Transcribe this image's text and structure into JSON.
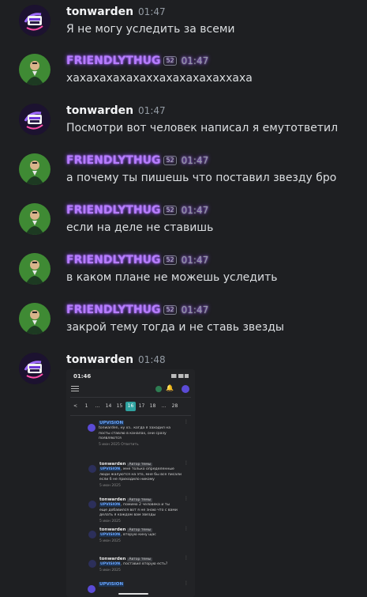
{
  "messages": [
    {
      "user": "tonwarden",
      "kind": "tw",
      "time": "01:47",
      "text": "Я не могу уследить за всеми"
    },
    {
      "user": "FRIENDLYTHUG",
      "kind": "fr",
      "badge": "52",
      "time": "01:47",
      "text": "хахахахахахаххахахахахаххаха"
    },
    {
      "user": "tonwarden",
      "kind": "tw",
      "time": "01:47",
      "text": "Посмотри вот человек написал я емутответил"
    },
    {
      "user": "FRIENDLYTHUG",
      "kind": "fr",
      "badge": "52",
      "time": "01:47",
      "text": "а почему ты пишешь что поставил звезду бро"
    },
    {
      "user": "FRIENDLYTHUG",
      "kind": "fr",
      "badge": "52",
      "time": "01:47",
      "text": "если на деле не ставишь"
    },
    {
      "user": "FRIENDLYTHUG",
      "kind": "fr",
      "badge": "52",
      "time": "01:47",
      "text": "в каком плане не можешь уследить"
    },
    {
      "user": "FRIENDLYTHUG",
      "kind": "fr",
      "badge": "52",
      "time": "01:47",
      "text": "закрой тему тогда и не ставь звезды"
    },
    {
      "user": "tonwarden",
      "kind": "tw",
      "time": "01:48",
      "text": ""
    }
  ],
  "attachment": {
    "status_time": "01:46",
    "pages": [
      "<",
      "1",
      "...",
      "14",
      "15",
      "16",
      "17",
      "18",
      "...",
      "28"
    ],
    "active_page": "16",
    "comments": [
      {
        "name": "UPVISION",
        "tag": "",
        "body": [
          "tonwarden, ну хз.. когда я заходил на",
          "посты ставлю в каналах, они сразу",
          "появляются"
        ],
        "date": "5 июн 2025",
        "reply": "Ответить"
      },
      {
        "name": "tonwarden",
        "tag": "Автор темы",
        "mention": "UPVISION",
        "body": [
          "мне только определенные",
          "люди жалуются на это, мне бы все писали",
          "если б не приходило никому"
        ],
        "date": "5 июн 2025"
      },
      {
        "name": "tonwarden",
        "tag": "Автор темы",
        "mention": "UPVISION",
        "body": [
          "помимо 2 человека и ты",
          "еще добавился вот я не знаю что с вами",
          "делать я каждом вам звезды"
        ],
        "date": "5 июн 2025"
      },
      {
        "name": "tonwarden",
        "tag": "Автор темы",
        "mention": "UPVISION",
        "body": [
          "вторую кину щас"
        ],
        "date": "5 июн 2025"
      },
      {
        "name": "tonwarden",
        "tag": "Автор темы",
        "mention": "UPVISION",
        "body": [
          "поставил вторую есть?"
        ],
        "date": "5 июн 2025"
      },
      {
        "name": "UPVISION",
        "tag": "",
        "body": [],
        "date": ""
      }
    ]
  }
}
